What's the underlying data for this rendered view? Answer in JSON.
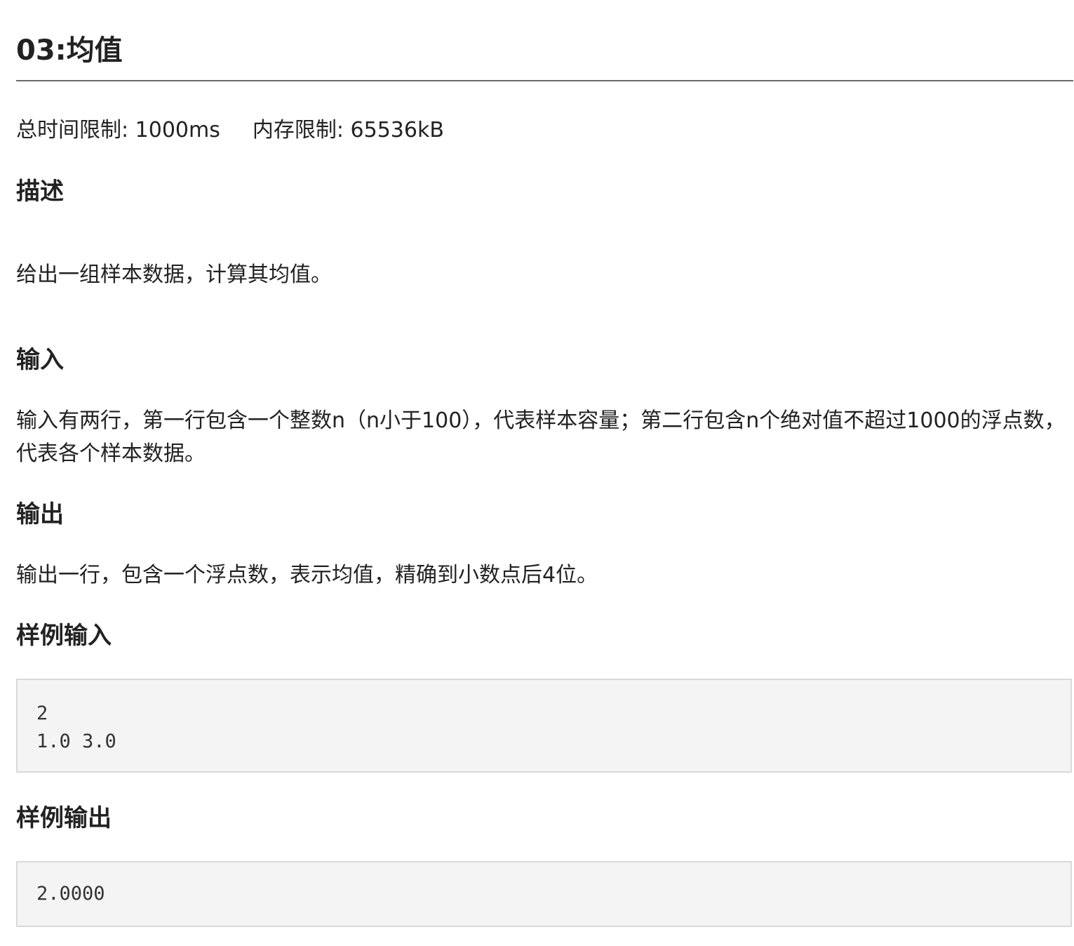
{
  "problem": {
    "title": "03:均值",
    "time_limit_label": "总时间限制: ",
    "time_limit_value": "1000ms",
    "memory_limit_label": "内存限制: ",
    "memory_limit_value": "65536kB"
  },
  "sections": {
    "description": {
      "heading": "描述",
      "text": "给出一组样本数据，计算其均值。"
    },
    "input": {
      "heading": "输入",
      "text": "输入有两行，第一行包含一个整数n（n小于100），代表样本容量；第二行包含n个绝对值不超过1000的浮点数，代表各个样本数据。"
    },
    "output": {
      "heading": "输出",
      "text": "输出一行，包含一个浮点数，表示均值，精确到小数点后4位。"
    },
    "sample_input": {
      "heading": "样例输入",
      "content": "2\n1.0 3.0"
    },
    "sample_output": {
      "heading": "样例输出",
      "content": "2.0000"
    }
  }
}
